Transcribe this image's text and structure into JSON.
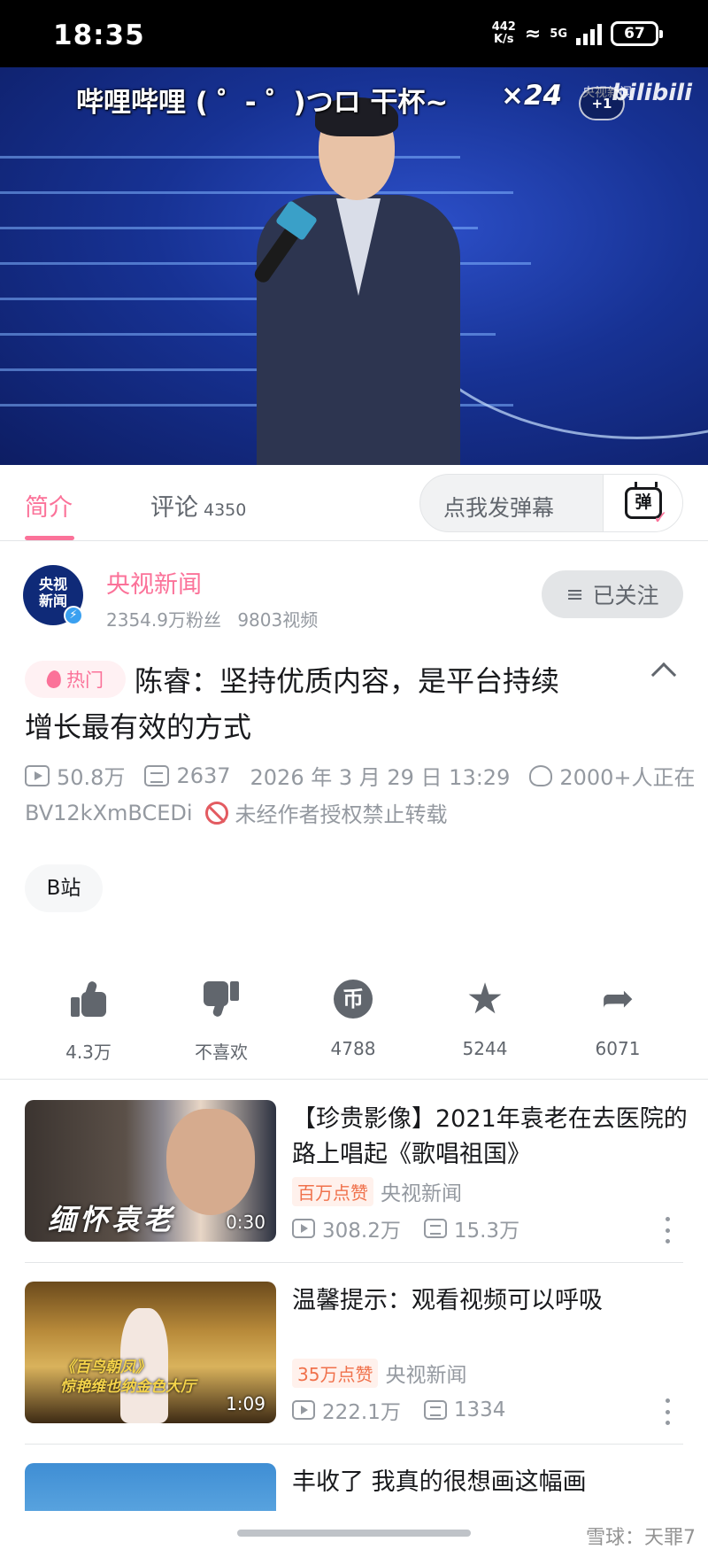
{
  "status_bar": {
    "time": "18:35",
    "net_speed_value": "442",
    "net_speed_unit": "K/s",
    "network": "5G",
    "battery": "67"
  },
  "video": {
    "danmaku_text": "哔哩哔哩 ( ゜- ゜)つロ 干杯~",
    "danmaku_count": "×24",
    "plus_badge": "+1",
    "watermark_news": "央视新闻",
    "watermark_logo": "bilibili"
  },
  "tabs": {
    "intro_label": "简介",
    "comments_label": "评论",
    "comments_count": "4350",
    "danmu_placeholder": "点我发弹幕",
    "danmu_button": "弹"
  },
  "author": {
    "avatar_text_1": "央视",
    "avatar_text_2": "新闻",
    "name": "央视新闻",
    "stats": "2354.9万粉丝 9803视频",
    "follow_label": "已关注",
    "follow_icon": "menu-icon"
  },
  "video_info": {
    "hot_badge": "热门",
    "title_line1": "陈睿：坚持优质内容，是平台持续",
    "title_line2": "增长最有效的方式",
    "views": "50.8万",
    "danmaku": "2637",
    "publish_time": "2026 年 3 月 29 日 13:29",
    "online": "2000+人正在",
    "bvid": "BV12kXmBCEDi",
    "copyright_notice": "未经作者授权禁止转载",
    "tag": "B站"
  },
  "actions": {
    "like": "4.3万",
    "dislike": "不喜欢",
    "coin": "4788",
    "coin_glyph": "币",
    "favorite": "5244",
    "share": "6071"
  },
  "recommendations": [
    {
      "title": "【珍贵影像】2021年袁老在去医院的路上唱起《歌唱祖国》",
      "cover_caption": "缅怀袁老",
      "duration": "0:30",
      "badge": "百万点赞",
      "author": "央视新闻",
      "views": "308.2万",
      "danmaku": "15.3万"
    },
    {
      "title": "温馨提示：观看视频可以呼吸",
      "cover_caption_1": "《百鸟朝凤》",
      "cover_caption_2": "惊艳维也纳金色大厅",
      "duration": "1:09",
      "badge": "35万点赞",
      "author": "央视新闻",
      "views": "222.1万",
      "danmaku": "1334"
    },
    {
      "title": "丰收了 我真的很想画这幅画"
    }
  ],
  "watermark": "雪球：天罪7",
  "colors": {
    "accent": "#fb7299",
    "text_primary": "#18191c",
    "text_secondary": "#61666d",
    "text_muted": "#9499a0",
    "video_bg": "#173294"
  }
}
